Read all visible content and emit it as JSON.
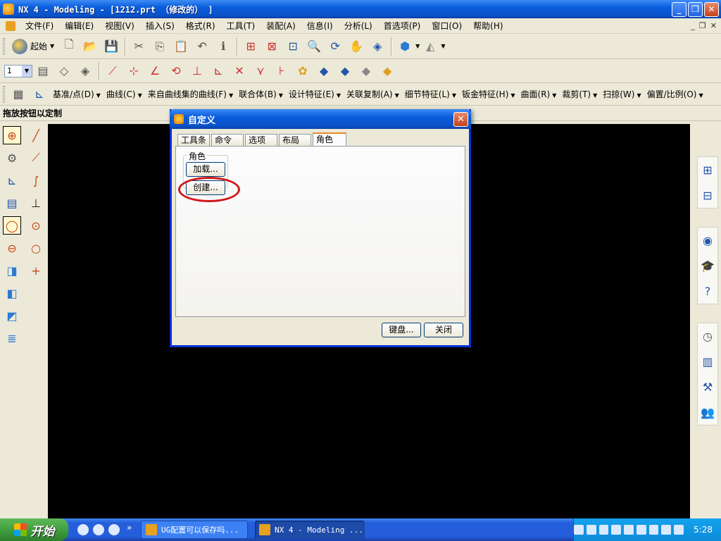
{
  "window": {
    "title": "NX 4 - Modeling - [1212.prt （修改的） ]",
    "controls": [
      "_",
      "❐",
      "✕"
    ]
  },
  "menubar": {
    "items": [
      "文件(F)",
      "编辑(E)",
      "视图(V)",
      "插入(S)",
      "格式(R)",
      "工具(T)",
      "装配(A)",
      "信息(I)",
      "分析(L)",
      "首选项(P)",
      "窗口(O)",
      "帮助(H)"
    ],
    "mdi_controls": [
      "_",
      "❐",
      "✕"
    ]
  },
  "toolbar1": {
    "start_label": "起始",
    "icons": [
      "new-icon",
      "open-icon",
      "save-icon",
      "cut-icon",
      "copy-icon",
      "paste-icon",
      "undo-icon",
      "info-icon",
      "fit-icon",
      "zoom-window-icon",
      "zoom-icon",
      "zoom-in-out-icon",
      "rotate-icon",
      "pan-icon",
      "refresh-icon",
      "render-style-icon",
      "view-orient-icon"
    ]
  },
  "toolbar2": {
    "layer_value": "1"
  },
  "toolbar3": {
    "items": [
      "基准/点(D)",
      "曲线(C)",
      "来自曲线集的曲线(F)",
      "联合体(B)",
      "设计特征(E)",
      "关联复制(A)",
      "细节特征(L)",
      "钣金特征(H)",
      "曲面(R)",
      "裁剪(T)",
      "扫掠(W)",
      "偏置/比例(O)"
    ]
  },
  "strip": {
    "label": "拖放按钮以定制"
  },
  "dialog": {
    "title": "自定义",
    "tabs": [
      "工具条",
      "命令",
      "选项",
      "布局",
      "角色"
    ],
    "active_tab": "角色",
    "group_label": "角色",
    "load_button": "加载...",
    "create_button": "创建...",
    "keyboard_button": "键盘...",
    "close_button": "关闭"
  },
  "taskbar": {
    "start_label": "开始",
    "task1": "UG配置可以保存吗...",
    "task2": "NX 4 - Modeling ...",
    "clock": "5:28",
    "quicklaunch_more": "»"
  },
  "colors": {
    "graphics_bg": "#000000",
    "highlight_ellipse": "#d01818",
    "xp_blue": "#0a5ddc"
  }
}
